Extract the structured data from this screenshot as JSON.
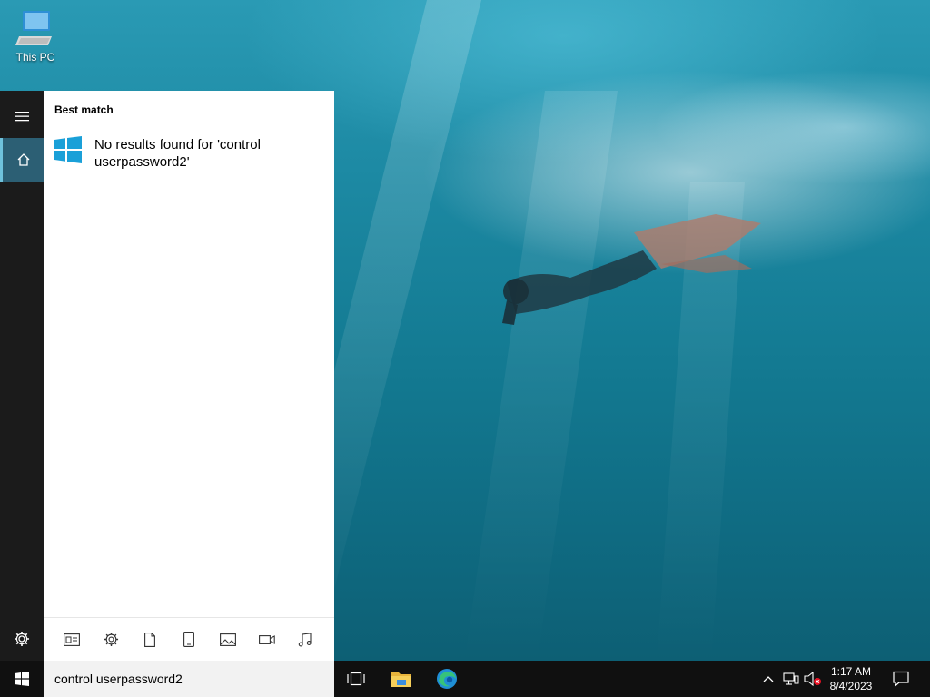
{
  "desktop": {
    "icons": [
      {
        "label": "This PC",
        "icon": "this-pc-icon"
      }
    ]
  },
  "start_menu": {
    "rail": {
      "menu_icon": "hamburger-icon",
      "home_icon": "home-icon",
      "settings_icon": "gear-icon"
    },
    "best_match_label": "Best match",
    "result": {
      "icon": "windows-logo-icon",
      "text": "No results found for 'control userpassword2'"
    },
    "filters": [
      {
        "icon": "apps-icon"
      },
      {
        "icon": "settings-icon"
      },
      {
        "icon": "document-icon"
      },
      {
        "icon": "device-icon"
      },
      {
        "icon": "photos-icon"
      },
      {
        "icon": "videos-icon"
      },
      {
        "icon": "music-icon"
      }
    ]
  },
  "taskbar": {
    "search_value": "control userpassword2",
    "items": [
      "task-view-icon",
      "file-explorer-icon",
      "edge-icon"
    ],
    "tray": {
      "chevron_icon": "chevron-up-icon",
      "network_icon": "network-icon",
      "volume_icon": "volume-muted-icon",
      "notification_icon": "notification-icon"
    },
    "time": "1:17 AM",
    "date": "8/4/2023"
  },
  "colors": {
    "accent": "#0078d7",
    "taskbar_bg": "#101010",
    "start_rail_bg": "#1b1b1b",
    "panel_bg": "#ffffff",
    "windows_logo": "#1aa0d8"
  }
}
